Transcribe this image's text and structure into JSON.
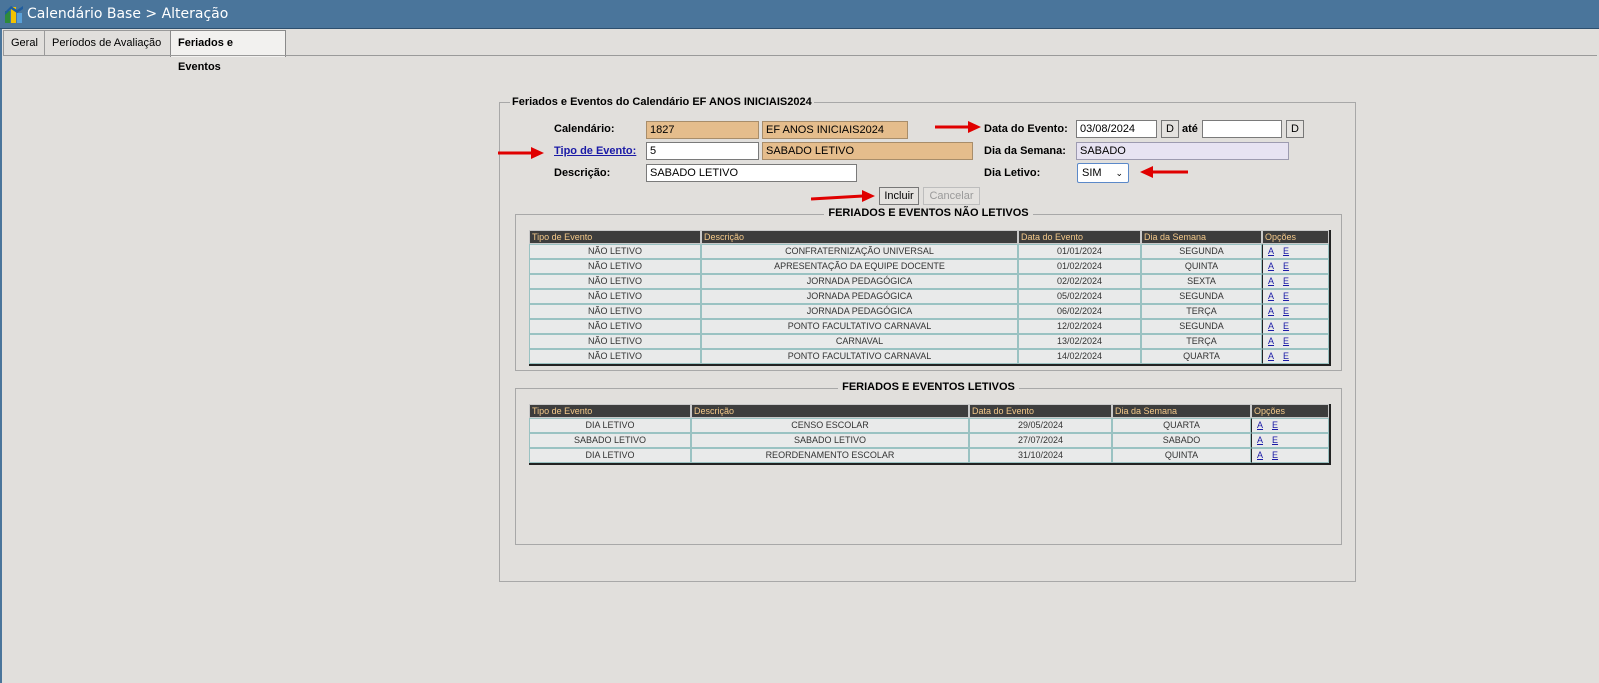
{
  "window": {
    "title": "Calendário Base > Alteração"
  },
  "tabs": [
    {
      "label": "Geral"
    },
    {
      "label": "Períodos de Avaliação"
    },
    {
      "label": "Feriados e Eventos"
    }
  ],
  "form": {
    "legend": "Feriados e Eventos do Calendário EF ANOS INICIAIS2024",
    "calendario_label": "Calendário:",
    "calendario_code": "1827",
    "calendario_name": "EF ANOS INICIAIS2024",
    "tipo_label": "Tipo de Evento:",
    "tipo_code": "5",
    "tipo_name": "SABADO LETIVO",
    "descricao_label": "Descrição:",
    "descricao_value": "SABADO LETIVO",
    "data_label": "Data do Evento:",
    "data_value": "03/08/2024",
    "date_button": "D",
    "ate_label": "até",
    "ate_value": "",
    "dia_semana_label": "Dia da Semana:",
    "dia_semana_value": "SABADO",
    "dia_letivo_label": "Dia Letivo:",
    "dia_letivo_value": "SIM",
    "incluir_label": "Incluir",
    "cancelar_label": "Cancelar"
  },
  "nao_letivos": {
    "title": "FERIADOS E EVENTOS NÃO LETIVOS",
    "headers": [
      "Tipo de Evento",
      "Descrição",
      "Data do Evento",
      "Dia da Semana",
      "Opções"
    ],
    "rows": [
      [
        "NÃO LETIVO",
        "CONFRATERNIZAÇÃO UNIVERSAL",
        "01/01/2024",
        "SEGUNDA"
      ],
      [
        "NÃO LETIVO",
        "APRESENTAÇÃO DA EQUIPE DOCENTE",
        "01/02/2024",
        "QUINTA"
      ],
      [
        "NÃO LETIVO",
        "JORNADA PEDAGÓGICA",
        "02/02/2024",
        "SEXTA"
      ],
      [
        "NÃO LETIVO",
        "JORNADA PEDAGÓGICA",
        "05/02/2024",
        "SEGUNDA"
      ],
      [
        "NÃO LETIVO",
        "JORNADA PEDAGÓGICA",
        "06/02/2024",
        "TERÇA"
      ],
      [
        "NÃO LETIVO",
        "PONTO FACULTATIVO CARNAVAL",
        "12/02/2024",
        "SEGUNDA"
      ],
      [
        "NÃO LETIVO",
        "CARNAVAL",
        "13/02/2024",
        "TERÇA"
      ],
      [
        "NÃO LETIVO",
        "PONTO FACULTATIVO CARNAVAL",
        "14/02/2024",
        "QUARTA"
      ]
    ]
  },
  "letivos": {
    "title": "FERIADOS E EVENTOS LETIVOS",
    "headers": [
      "Tipo de Evento",
      "Descrição",
      "Data do Evento",
      "Dia da Semana",
      "Opções"
    ],
    "rows": [
      [
        "DIA LETIVO",
        "CENSO ESCOLAR",
        "29/05/2024",
        "QUARTA"
      ],
      [
        "SABADO LETIVO",
        "SABADO LETIVO",
        "27/07/2024",
        "SABADO"
      ],
      [
        "DIA LETIVO",
        "REORDENAMENTO ESCOLAR",
        "31/10/2024",
        "QUINTA"
      ]
    ]
  },
  "row_actions": [
    "A",
    "E"
  ],
  "colors": {
    "titlebar": "#4a759b",
    "readonly_field": "#e5bd8c",
    "table_header": "#3d3d3d",
    "arrow": "#e00000"
  }
}
